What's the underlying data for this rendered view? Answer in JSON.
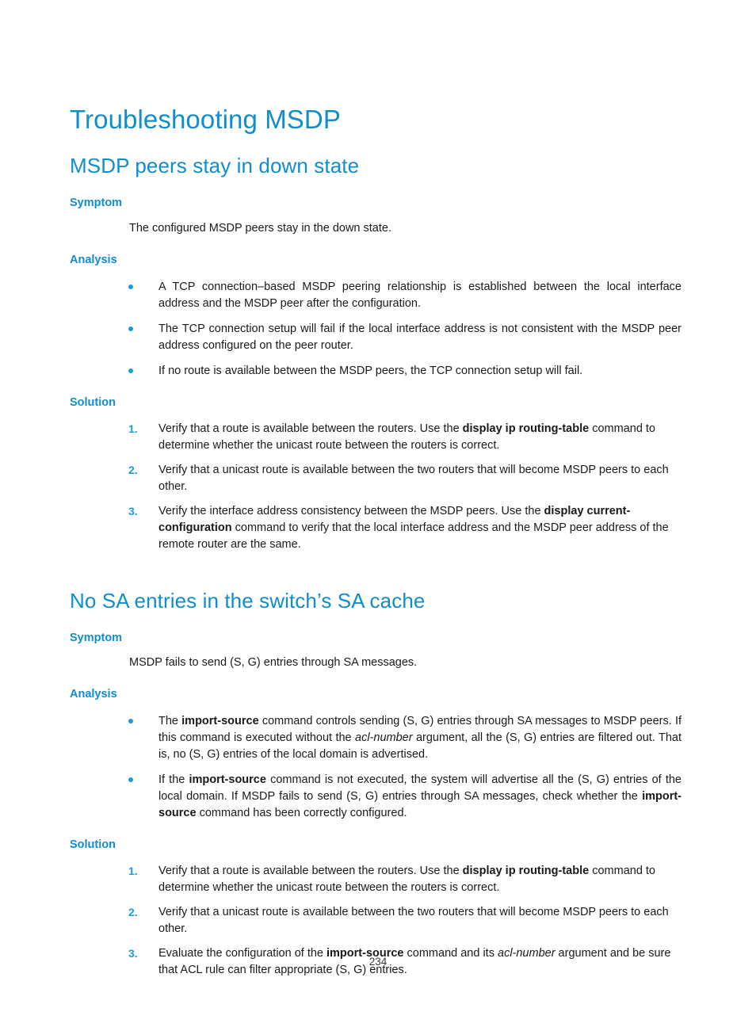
{
  "document": {
    "title": "Troubleshooting MSDP",
    "page_number": "234",
    "accent_color": "#0f8ecb",
    "bullet_color": "#1b9bd7",
    "body_color": "#1a1a1a"
  },
  "sections": [
    {
      "heading": "MSDP peers stay in down state",
      "symptom_label": "Symptom",
      "symptom_text": "The configured MSDP peers stay in the down state.",
      "analysis_label": "Analysis",
      "analysis_items": [
        "A TCP connection–based MSDP peering relationship is established between the local interface address and the MSDP peer after the configuration.",
        "The TCP connection setup will fail if the local interface address is not consistent with the MSDP peer address configured on the peer router.",
        "If no route is available between the MSDP peers, the TCP connection setup will fail."
      ],
      "analysis_items_html": [
        "A TCP connection–based MSDP peering relationship is established between the local interface address and the MSDP peer after the configuration.",
        "The TCP connection setup will fail if the local interface address is not consistent with the MSDP peer address configured on the peer router.",
        "If no route is available between the MSDP peers, the TCP connection setup will fail."
      ],
      "solution_label": "Solution",
      "solution_items": [
        "Verify that a route is available between the routers. Use the display ip routing-table command to determine whether the unicast route between the routers is correct.",
        "Verify that a unicast route is available between the two routers that will become MSDP peers to each other.",
        "Verify the interface address consistency between the MSDP peers. Use the display current-configuration command to verify that the local interface address and the MSDP peer address of the remote router are the same."
      ],
      "solution_items_html": [
        "Verify that a route is available between the routers. Use the <b>display ip routing-table</b> command to determine whether the unicast route between the routers is correct.",
        "Verify that a unicast route is available between the two routers that will become MSDP peers to each other.",
        "Verify the interface address consistency between the MSDP peers. Use the <b>display current-configuration</b> command to verify that the local interface address and the MSDP peer address of the remote router are the same."
      ],
      "solution_numbers": [
        "1.",
        "2.",
        "3."
      ]
    },
    {
      "heading": "No SA entries in the switch’s SA cache",
      "symptom_label": "Symptom",
      "symptom_text": "MSDP fails to send (S, G) entries through SA messages.",
      "analysis_label": "Analysis",
      "analysis_items": [
        "The import-source command controls sending (S, G) entries through SA messages to MSDP peers. If this command is executed without the acl-number argument, all the (S, G) entries are filtered out. That is, no (S, G) entries of the local domain is advertised.",
        "If the import-source command is not executed, the system will advertise all the (S, G) entries of the local domain. If MSDP fails to send (S, G) entries through SA messages, check whether the import-source command has been correctly configured."
      ],
      "analysis_items_html": [
        "The <b>import-source</b> command controls sending (S, G) entries through SA messages to MSDP peers. If this command is executed without the <i>acl-number</i> argument, all the (S, G) entries are filtered out. That is, no (S, G) entries of the local domain is advertised.",
        "If the <b>import-source</b> command is not executed, the system will advertise all the (S, G) entries of the local domain. If MSDP fails to send (S, G) entries through SA messages, check whether the <b>import-source</b> command has been correctly configured."
      ],
      "solution_label": "Solution",
      "solution_items": [
        "Verify that a route is available between the routers. Use the display ip routing-table command to determine whether the unicast route between the routers is correct.",
        "Verify that a unicast route is available between the two routers that will become MSDP peers to each other.",
        "Evaluate the configuration of the import-source command and its acl-number argument and be sure that ACL rule can filter appropriate (S, G) entries."
      ],
      "solution_items_html": [
        "Verify that a route is available between the routers. Use the <b>display ip routing-table</b> command to determine whether the unicast route between the routers is correct.",
        "Verify that a unicast route is available between the two routers that will become MSDP peers to each other.",
        "Evaluate the configuration of the <b>import-source</b> command and its <i>acl-number</i> argument and be sure that ACL rule can filter appropriate (S, G) entries."
      ],
      "solution_numbers": [
        "1.",
        "2.",
        "3."
      ]
    }
  ]
}
